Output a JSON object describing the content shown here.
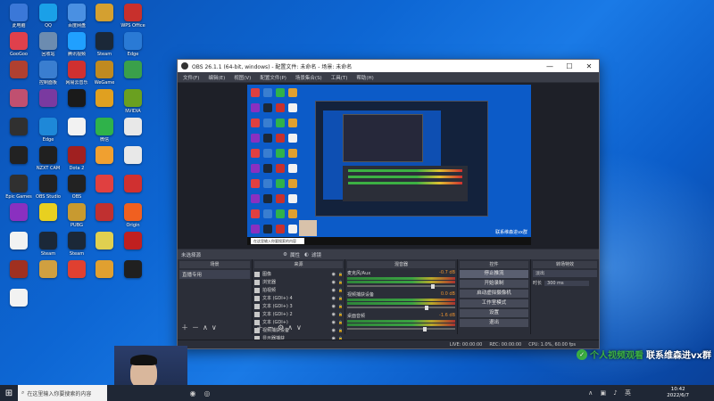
{
  "desktop": {
    "icons": [
      {
        "label": "此电脑",
        "color": "#3b78d8"
      },
      {
        "label": "QQ",
        "color": "#1aa0e8"
      },
      {
        "label": "百度网盘",
        "color": "#4a90e2"
      },
      {
        "label": "",
        "color": "#d4a030"
      },
      {
        "label": "WPS Office",
        "color": "#c8302c"
      },
      {
        "label": "GooGoo",
        "color": "#e0404c"
      },
      {
        "label": "回收站",
        "color": "#6c8cb0"
      },
      {
        "label": "腾讯视频",
        "color": "#20a0ff"
      },
      {
        "label": "Steam",
        "color": "#1b2838"
      },
      {
        "label": "Edge",
        "color": "#2a7ad5"
      },
      {
        "label": "",
        "color": "#b04030"
      },
      {
        "label": "控制面板",
        "color": "#3a7ed0"
      },
      {
        "label": "网易云音乐",
        "color": "#d03030"
      },
      {
        "label": "WeGame",
        "color": "#c08a20"
      },
      {
        "label": "",
        "color": "#3aa04a"
      },
      {
        "label": "",
        "color": "#c05070"
      },
      {
        "label": "",
        "color": "#7a3aa0"
      },
      {
        "label": "",
        "color": "#1a1a1a"
      },
      {
        "label": "",
        "color": "#e0a020"
      },
      {
        "label": "NVIDIA",
        "color": "#6aa020"
      },
      {
        "label": "",
        "color": "#303030"
      },
      {
        "label": "Edge",
        "color": "#1e88d8"
      },
      {
        "label": "",
        "color": "#f2f2f2"
      },
      {
        "label": "微信",
        "color": "#2fb24a"
      },
      {
        "label": "",
        "color": "#e8e8e8"
      },
      {
        "label": "",
        "color": "#222"
      },
      {
        "label": "NZXT CAM",
        "color": "#202020"
      },
      {
        "label": "Dota 2",
        "color": "#a02020"
      },
      {
        "label": "",
        "color": "#f0a030"
      },
      {
        "label": "",
        "color": "#e8e8e8"
      },
      {
        "label": "Epic Games",
        "color": "#303030"
      },
      {
        "label": "OBS Studio",
        "color": "#222"
      },
      {
        "label": "OBS",
        "color": "#222"
      },
      {
        "label": "",
        "color": "#e04040"
      },
      {
        "label": "",
        "color": "#d03030"
      },
      {
        "label": "",
        "color": "#8a30c0"
      },
      {
        "label": "",
        "color": "#e8d020"
      },
      {
        "label": "PUBG",
        "color": "#c89a30"
      },
      {
        "label": "",
        "color": "#c03030"
      },
      {
        "label": "Origin",
        "color": "#f06020"
      },
      {
        "label": "",
        "color": "#f2f2f2"
      },
      {
        "label": "Steam",
        "color": "#1b2838"
      },
      {
        "label": "Steam",
        "color": "#1b2838"
      },
      {
        "label": "",
        "color": "#e0d050"
      },
      {
        "label": "",
        "color": "#c02020"
      },
      {
        "label": "",
        "color": "#a03020"
      },
      {
        "label": "",
        "color": "#d0a040"
      },
      {
        "label": "",
        "color": "#e04030"
      },
      {
        "label": "",
        "color": "#e0a030"
      },
      {
        "label": "",
        "color": "#202020"
      },
      {
        "label": "",
        "color": "#f2f2f2"
      }
    ]
  },
  "obs": {
    "title": "OBS 26.1.1 (64-bit, windows) - 配置文件: 未命名 - 场景: 未命名",
    "menu": [
      "文件(F)",
      "编辑(E)",
      "视图(V)",
      "配置文件(P)",
      "场景集合(S)",
      "工具(T)",
      "帮助(H)"
    ],
    "inner_watermark": "联系维森进vx群",
    "inner_search": "在这里输入你要搜索的内容",
    "dock_label": "未选择源",
    "tabs": {
      "properties": "属性",
      "filters": "滤镜"
    },
    "scenes": {
      "header": "场景",
      "item": "直播专用"
    },
    "sources": {
      "header": "来源",
      "items": [
        "图像",
        "浏览器",
        "拍视频",
        "文本 (GDI+) 4",
        "文本 (GDI+) 3",
        "文本 (GDI+) 2",
        "文本 (GDI+)",
        "视频捕获设备",
        "显示器捕获"
      ]
    },
    "mixer": {
      "header": "混音器",
      "channels": [
        {
          "name": "麦克风/Aux",
          "db": "-0.7 dB",
          "level": 0.78
        },
        {
          "name": "视频捕获设备",
          "db": "0.0 dB",
          "level": 0.72
        },
        {
          "name": "桌面音频",
          "db": "-1.6 dB",
          "level": 0.7
        }
      ]
    },
    "transitions": {
      "header": "转场特效",
      "type": "淡出",
      "duration_label": "时长",
      "duration_value": "300 ms"
    },
    "controls": {
      "header": "控件",
      "buttons": [
        "停止推流",
        "开始录制",
        "启动虚拟摄像机",
        "工作室模式",
        "设置",
        "退出"
      ]
    },
    "status": {
      "live": "LIVE: 00:00:00",
      "rec": "REC: 00:00:00",
      "cpu": "CPU: 1.0%, 60.00 fps"
    }
  },
  "watermark": {
    "part_a": "个人视频观看",
    "part_b": "联系维森进vx群"
  },
  "taskbar": {
    "search_placeholder": "在这里输入你要搜索的内容",
    "time": "10:42",
    "date": "2022/6/7"
  }
}
